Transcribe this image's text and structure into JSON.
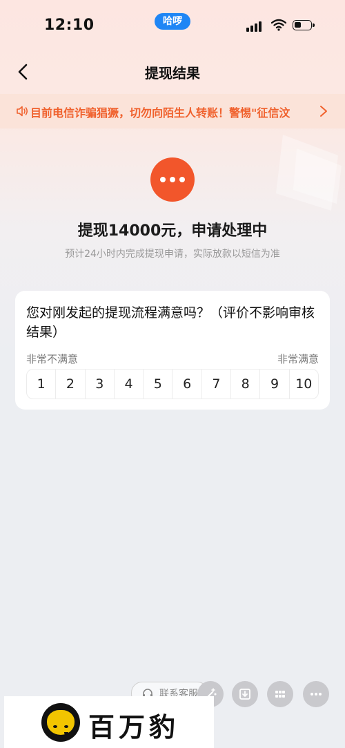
{
  "status_bar": {
    "time": "12:10",
    "pill_label": "哈啰"
  },
  "nav": {
    "title": "提现结果"
  },
  "notice": {
    "text": "目前电信诈骗猖獗，切勿向陌生人转账！警惕\"征信汶"
  },
  "result": {
    "headline": "提现14000元，申请处理中",
    "subline": "预计24小时内完成提现申请，实际放款以短信为准"
  },
  "survey": {
    "question": "您对刚发起的提现流程满意吗？（评价不影响审核结果）",
    "low_label": "非常不满意",
    "high_label": "非常满意",
    "options": [
      "1",
      "2",
      "3",
      "4",
      "5",
      "6",
      "7",
      "8",
      "9",
      "10"
    ]
  },
  "service": {
    "label": "联系客服"
  },
  "watermark": {
    "text": "百万豹"
  },
  "colors": {
    "accent": "#f2562b",
    "notice_text": "#f0612d",
    "pill": "#1f86f5"
  }
}
